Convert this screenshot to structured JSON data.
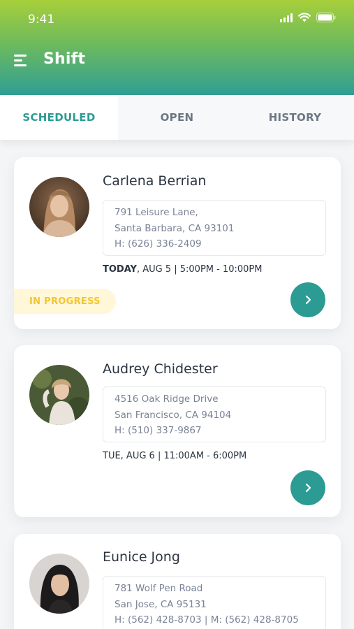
{
  "status_bar": {
    "time": "9:41"
  },
  "header": {
    "title": "Shift",
    "menu_icon": "hamburger-menu-icon"
  },
  "tabs": [
    {
      "label": "SCHEDULED",
      "active": true
    },
    {
      "label": "OPEN",
      "active": false
    },
    {
      "label": "HISTORY",
      "active": false
    }
  ],
  "shifts": [
    {
      "name": "Carlena Berrian",
      "address_line1": "791 Leisure Lane,",
      "address_line2": "Santa Barbara, CA 93101",
      "phone": "H: (626) 336-2409",
      "day_prefix": "TODAY",
      "time": ", AUG 5 | 5:00PM - 10:00PM",
      "status": "IN PROGRESS"
    },
    {
      "name": "Audrey Chidester",
      "address_line1": "4516 Oak Ridge Drive",
      "address_line2": "San Francisco, CA 94104",
      "phone": "H: (510) 337-9867",
      "day_prefix": "",
      "time": "TUE, AUG 6 | 11:00AM - 6:00PM",
      "status": ""
    },
    {
      "name": "Eunice Jong",
      "address_line1": "781 Wolf Pen Road",
      "address_line2": "San Jose, CA 95131",
      "phone": "H: (562) 428-8703 | M: (562) 428-8705",
      "day_prefix": "",
      "time": "",
      "status": ""
    }
  ],
  "colors": {
    "accent": "#2c9b93",
    "header_top": "#a7cf3a",
    "status_badge_text": "#f2c62e",
    "status_badge_bg": "#fff7d8"
  }
}
